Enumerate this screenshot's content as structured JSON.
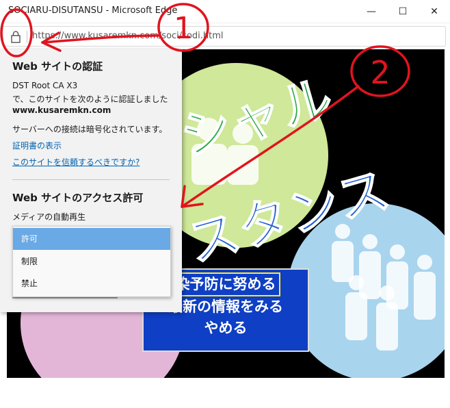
{
  "window": {
    "title": "SOCIARU-DISUTANSU - Microsoft Edge",
    "minimize_glyph": "—",
    "maximize_glyph": "☐",
    "close_glyph": "✕"
  },
  "addressbar": {
    "url": "https://www.kusaremkn.com/soci/sodi.html"
  },
  "flyout": {
    "cert_heading": "Web サイトの認証",
    "issuer": "DST Root CA X3",
    "verified_text": "で、このサイトを次のように認証しました",
    "domain": "www.kusaremkn.com",
    "encrypted_text": "サーバーへの接続は暗号化されています。",
    "show_cert_link": "証明書の表示",
    "trust_link": "このサイトを信頼するべきですか?",
    "permissions_heading": "Web サイトのアクセス許可",
    "autoplay_label": "メディアの自動再生",
    "autoplay_options": [
      "許可",
      "制限",
      "禁止"
    ],
    "autoplay_selected": "許可"
  },
  "page": {
    "banner_top": "シャル",
    "banner_bottom": "スタンス",
    "info_lines": [
      "染予防に努める",
      "最新の情報をみる",
      "やめる"
    ]
  },
  "annotations": {
    "mark1": "1",
    "mark2": "2",
    "color": "#e0141e"
  }
}
